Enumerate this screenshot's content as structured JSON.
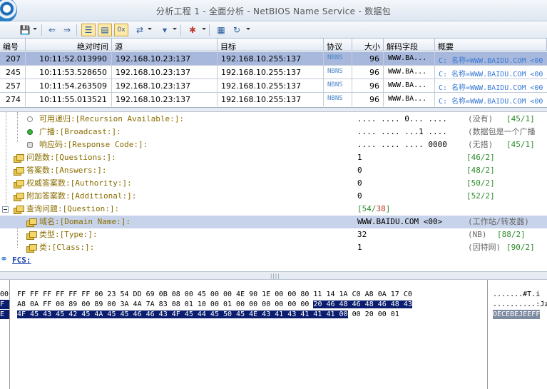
{
  "window": {
    "title": "分析工程 1 - 全面分析 - NetBIOS Name Service - 数据包"
  },
  "toolbar": {
    "icons": [
      "save-icon",
      "back-icon",
      "forward-icon",
      "list-view-icon",
      "detail-view-icon",
      "hex-view-icon",
      "refresh-filter-icon",
      "filter-icon",
      "font-icon",
      "copy-icon",
      "reload-icon"
    ],
    "hex_label": "0x"
  },
  "packet_list": {
    "columns": [
      "编号",
      "绝对时间",
      "源",
      "目标",
      "协议",
      "大小",
      "解码字段",
      "概要"
    ],
    "rows": [
      {
        "no": "207",
        "time": "10:11:52.013990",
        "src": "192.168.10.23:137",
        "dst": "192.168.10.255:137",
        "proto": "NBNS",
        "size": "96",
        "decode": "WWW.BA...",
        "summary": "C: 名称=WWW.BAIDU.COM <00"
      },
      {
        "no": "245",
        "time": "10:11:53.528650",
        "src": "192.168.10.23:137",
        "dst": "192.168.10.255:137",
        "proto": "NBNS",
        "size": "96",
        "decode": "WWW.BA...",
        "summary": "C: 名称=WWW.BAIDU.COM <00"
      },
      {
        "no": "257",
        "time": "10:11:54.263509",
        "src": "192.168.10.23:137",
        "dst": "192.168.10.255:137",
        "proto": "NBNS",
        "size": "96",
        "decode": "WWW.BA...",
        "summary": "C: 名称=WWW.BAIDU.COM <00"
      },
      {
        "no": "274",
        "time": "10:11:55.013521",
        "src": "192.168.10.23:137",
        "dst": "192.168.10.255:137",
        "proto": "NBNS",
        "size": "96",
        "decode": "WWW.BA...",
        "summary": "C: 名称=WWW.BAIDU.COM <00"
      }
    ]
  },
  "decode_tree": [
    {
      "name": "可用递归:[Recursion Available:]:",
      "value": ".... .... 0... ....",
      "desc": "(没有)",
      "pos_a": "45",
      "pos_b": "1"
    },
    {
      "name": "广播:[Broadcast:]:",
      "value": ".... .... ...1 ....",
      "desc": "(数据包是一个广播",
      "pos_a": "",
      "pos_b": ""
    },
    {
      "name": "响应码:[Response Code:]:",
      "value": ".... .... .... 0000",
      "desc": "(无措)",
      "pos_a": "45",
      "pos_b": "1"
    },
    {
      "name": "问题数:[Questions:]:",
      "value": "1",
      "desc": "",
      "pos_a": "46",
      "pos_b": "2"
    },
    {
      "name": "答案数:[Answers:]:",
      "value": "0",
      "desc": "",
      "pos_a": "48",
      "pos_b": "2"
    },
    {
      "name": "权威答案数:[Authority:]:",
      "value": "0",
      "desc": "",
      "pos_a": "50",
      "pos_b": "2"
    },
    {
      "name": "附加答案数:[Additional:]:",
      "value": "0",
      "desc": "",
      "pos_a": "52",
      "pos_b": "2"
    },
    {
      "name": "查询问题:[Question:]:",
      "value": "",
      "desc": "",
      "pos_a": "54",
      "pos_b": "38"
    },
    {
      "name": "域名:[Domain Name:]:",
      "value": "WWW.BAIDU.COM <00>",
      "desc": "(工作站/转发器)",
      "pos_a": "",
      "pos_b": ""
    },
    {
      "name": "类型:[Type:]:",
      "value": "32",
      "desc": "(NB)",
      "pos_a": "88",
      "pos_b": "2"
    },
    {
      "name": "类:[Class:]:",
      "value": "1",
      "desc": "(因特网)",
      "pos_a": "90",
      "pos_b": "2"
    },
    {
      "name": "FCS:",
      "value": "",
      "desc": "",
      "pos_a": "",
      "pos_b": ""
    }
  ],
  "hex": {
    "offsets": [
      "00",
      "A8",
      ""
    ],
    "line1": "FF FF FF FF FF FF 00 23 54 DD 69 0B 08 00 45 00 00 4E 90 1E 00 00 80 11 14 1A C0 A8 0A 17 C0",
    "line2_plain": "A8 0A FF 00 89 00 89 00 3A 4A 7A 83 08 01 10 00 01 00 00 00 00 00 00 ",
    "line2_sel": "20 46 48 46 48 46 48 43",
    "line3_sel": "4F 45 43 45 42 45 4A 45 45 46 46 43 4F 45 44 45 50 45 4E 43 41 43 41 41 41 00",
    "line3_plain": " 00 20 00 01",
    "ascii1": ".......#T.i",
    "ascii2": "..........:Jz",
    "ascii3": "OECEBEJEEFF",
    "left_frag": [
      "F",
      "E"
    ]
  }
}
